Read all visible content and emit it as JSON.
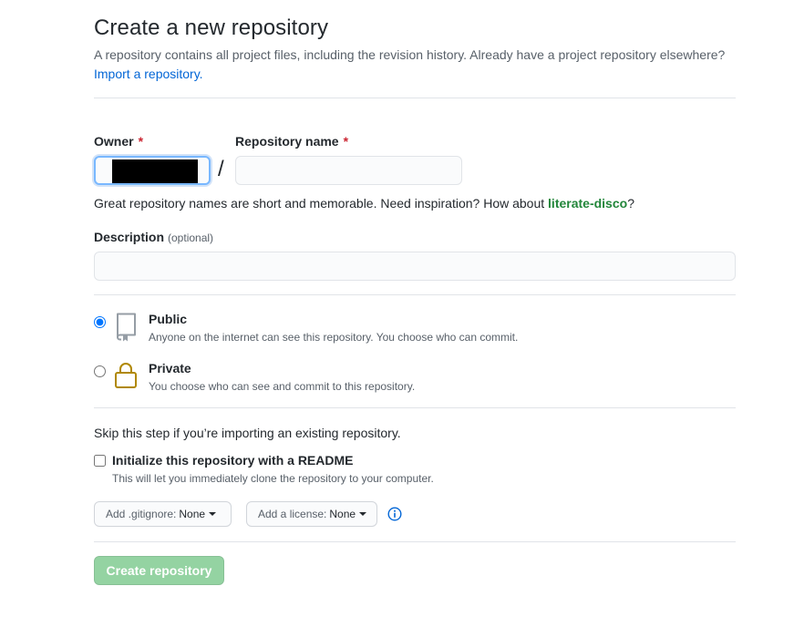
{
  "header": {
    "title": "Create a new repository",
    "subtitle": "A repository contains all project files, including the revision history. Already have a project repository elsewhere?",
    "import_link": "Import a repository."
  },
  "form": {
    "owner": {
      "label": "Owner",
      "required_mark": "*"
    },
    "slash": "/",
    "repo_name": {
      "label": "Repository name",
      "required_mark": "*",
      "value": ""
    },
    "name_hint": {
      "text": "Great repository names are short and memorable. Need inspiration? How about ",
      "suggestion": "literate-disco",
      "end": "?"
    },
    "description": {
      "label": "Description",
      "optional": "(optional)",
      "value": ""
    },
    "visibility": [
      {
        "title": "Public",
        "desc": "Anyone on the internet can see this repository. You choose who can commit.",
        "checked": true,
        "icon": "repo-icon"
      },
      {
        "title": "Private",
        "desc": "You choose who can see and commit to this repository.",
        "checked": false,
        "icon": "lock-icon"
      }
    ],
    "skip_text": "Skip this step if you’re importing an existing repository.",
    "readme": {
      "label": "Initialize this repository with a README",
      "desc": "This will let you immediately clone the repository to your computer.",
      "checked": false
    },
    "gitignore": {
      "label": "Add .gitignore:",
      "value": "None"
    },
    "license": {
      "label": "Add a license:",
      "value": "None"
    },
    "submit": "Create repository"
  },
  "colors": {
    "link": "#0366d6",
    "suggestion": "#22863a",
    "required": "#cb2431",
    "create_button_disabled": "#94d3a2",
    "icon_muted": "#959da5",
    "lock_icon": "#b08800"
  }
}
